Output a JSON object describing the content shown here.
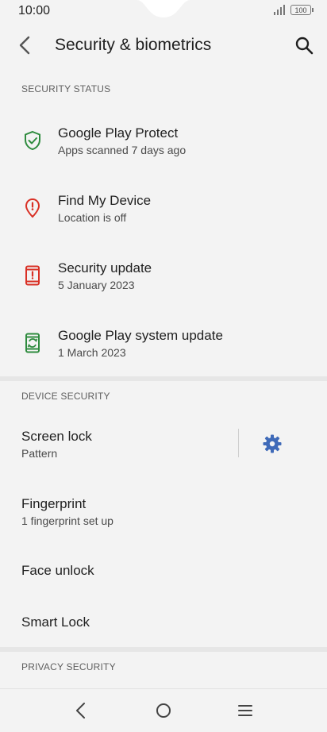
{
  "status_bar": {
    "time": "10:00",
    "battery": "100"
  },
  "app_bar": {
    "title": "Security & biometrics",
    "back_icon": "back-arrow-icon",
    "search_icon": "search-icon"
  },
  "sections": {
    "security_status": "SECURITY STATUS",
    "device_security": "DEVICE SECURITY",
    "privacy_security": "PRIVACY SECURITY"
  },
  "security_status_items": [
    {
      "title": "Google Play Protect",
      "subtitle": "Apps scanned 7 days ago",
      "icon": "shield-check-icon",
      "color": "#2e8b3e"
    },
    {
      "title": "Find My Device",
      "subtitle": "Location is off",
      "icon": "location-alert-icon",
      "color": "#d93025"
    },
    {
      "title": "Security update",
      "subtitle": "5 January 2023",
      "icon": "phone-alert-icon",
      "color": "#d93025"
    },
    {
      "title": "Google Play system update",
      "subtitle": "1 March 2023",
      "icon": "phone-update-icon",
      "color": "#2e8b3e"
    }
  ],
  "device_security_items": [
    {
      "title": "Screen lock",
      "subtitle": "Pattern"
    },
    {
      "title": "Fingerprint",
      "subtitle": "1 fingerprint set up"
    },
    {
      "title": "Face unlock"
    },
    {
      "title": "Smart Lock"
    }
  ],
  "colors": {
    "accent": "#3f6ab8",
    "background": "#f3f3f3",
    "band": "#e6e6e6"
  }
}
